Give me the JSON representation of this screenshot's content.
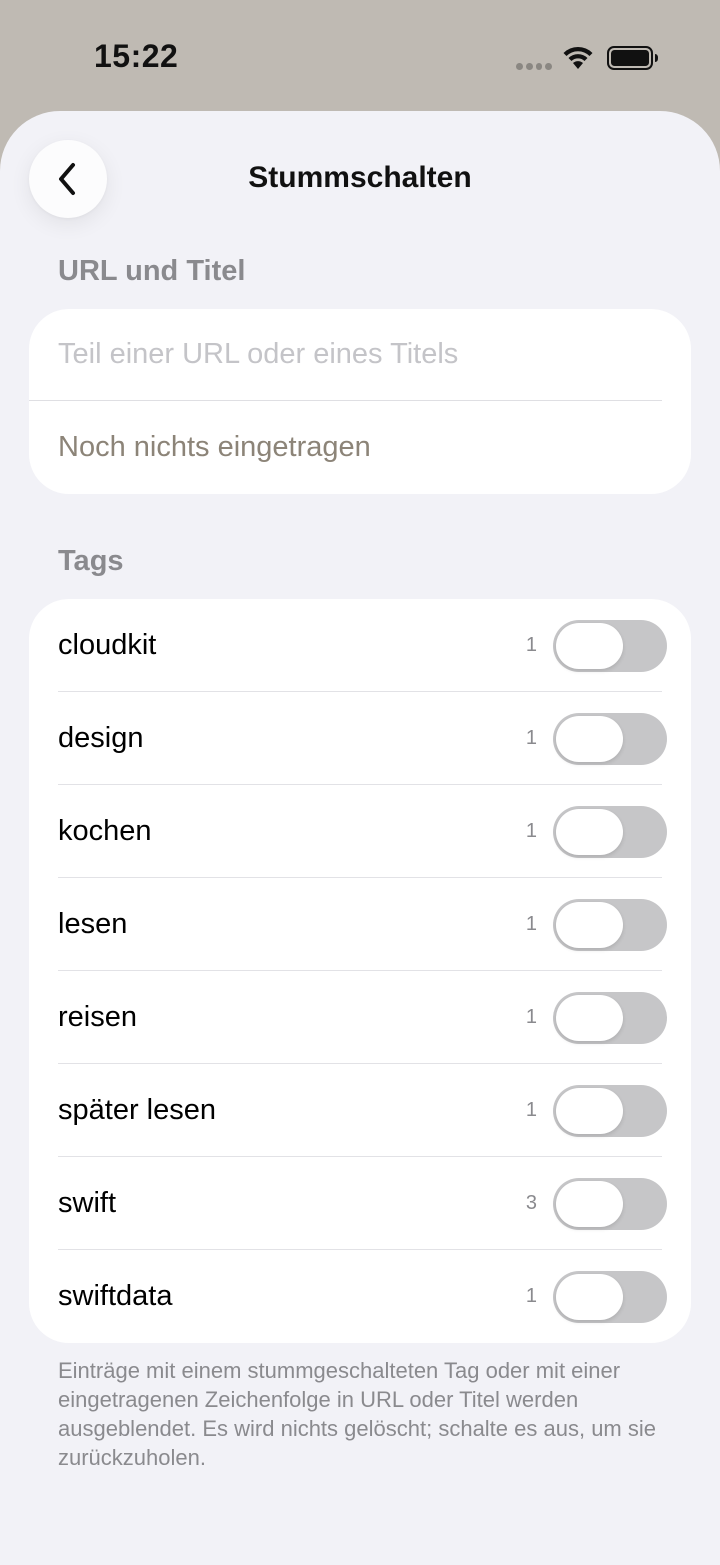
{
  "status": {
    "time": "15:22"
  },
  "nav": {
    "title": "Stummschalten",
    "back_icon": "chevron-left-icon"
  },
  "url_section": {
    "header": "URL und Titel",
    "input_placeholder": "Teil einer URL oder eines Titels",
    "input_value": "",
    "empty_text": "Noch nichts eingetragen"
  },
  "tags_section": {
    "header": "Tags",
    "items": [
      {
        "name": "cloudkit",
        "count": "1",
        "muted": false
      },
      {
        "name": "design",
        "count": "1",
        "muted": false
      },
      {
        "name": "kochen",
        "count": "1",
        "muted": false
      },
      {
        "name": "lesen",
        "count": "1",
        "muted": false
      },
      {
        "name": "reisen",
        "count": "1",
        "muted": false
      },
      {
        "name": "später lesen",
        "count": "1",
        "muted": false
      },
      {
        "name": "swift",
        "count": "3",
        "muted": false
      },
      {
        "name": "swiftdata",
        "count": "1",
        "muted": false
      }
    ],
    "footer": "Einträge mit einem stummgeschalteten Tag oder mit einer eingetragenen Zeichenfolge in URL oder Titel werden ausgeblendet. Es wird nichts gelöscht; schalte es aus, um sie zurückzuholen."
  },
  "colors": {
    "top_background": "#bfbab3",
    "sheet_background": "#f2f2f7",
    "toggle_off": "#c6c6c8",
    "secondary_text": "#8a8a8e"
  }
}
